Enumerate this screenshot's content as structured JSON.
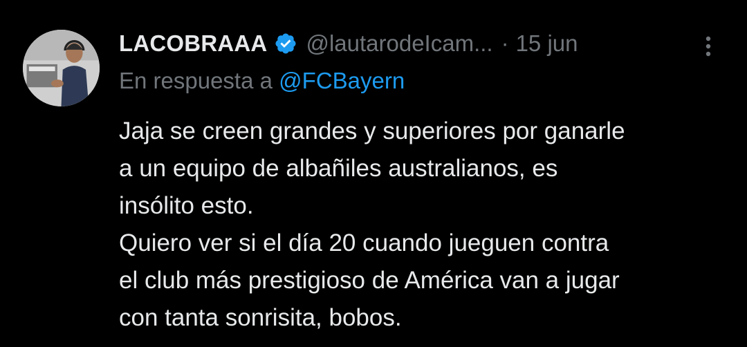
{
  "tweet": {
    "display_name": "LACOBRAAA",
    "handle": "@lautarodeIcam...",
    "separator": "·",
    "date": "15 jun",
    "reply_prefix": "En respuesta a",
    "reply_handle": "@FCBayern",
    "body_lines": [
      "Jaja se creen grandes y superiores por ganarle",
      "a un equipo de albañiles australianos, es",
      "insólito esto.",
      "Quiero ver si el día 20 cuando jueguen contra",
      "el club más prestigioso de América van a jugar",
      "con tanta sonrisita, bobos."
    ]
  },
  "icons": {
    "verified": "verified-badge-icon",
    "more": "more-options-icon"
  },
  "colors": {
    "background": "#000000",
    "primary_text": "#e7e9ea",
    "secondary_text": "#71767b",
    "link": "#1d9bf0",
    "verified": "#1d9bf0"
  }
}
